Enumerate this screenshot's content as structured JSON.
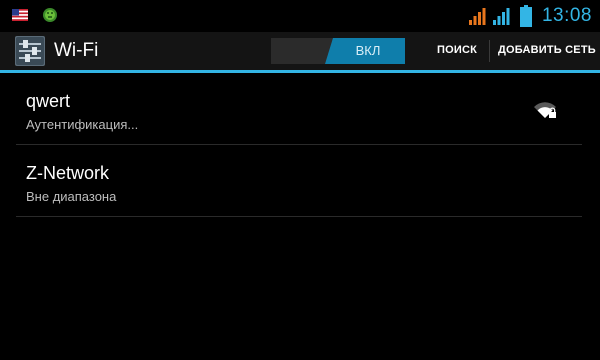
{
  "status_bar": {
    "left_icons": [
      "us-flag-icon",
      "android-icon"
    ],
    "right_icons": [
      "signal-orange-icon",
      "signal-blue-icon",
      "battery-icon"
    ],
    "time": "13:08",
    "colors": {
      "accent": "#33b5e5",
      "signal_orange": "#e8761d",
      "signal_blue": "#33b5e5"
    }
  },
  "action_bar": {
    "icon": "settings-icon",
    "title": "Wi-Fi",
    "toggle": {
      "label": "ВКЛ",
      "state": "on",
      "color": "#0f7eab"
    },
    "actions": [
      {
        "label": "ПОИСК"
      },
      {
        "label": "ДОБАВИТЬ СЕТЬ"
      }
    ]
  },
  "networks": [
    {
      "name": "qwert",
      "status": "Аутентификация...",
      "icon": "wifi-locked-icon"
    },
    {
      "name": "Z-Network",
      "status": "Вне диапазона"
    }
  ]
}
